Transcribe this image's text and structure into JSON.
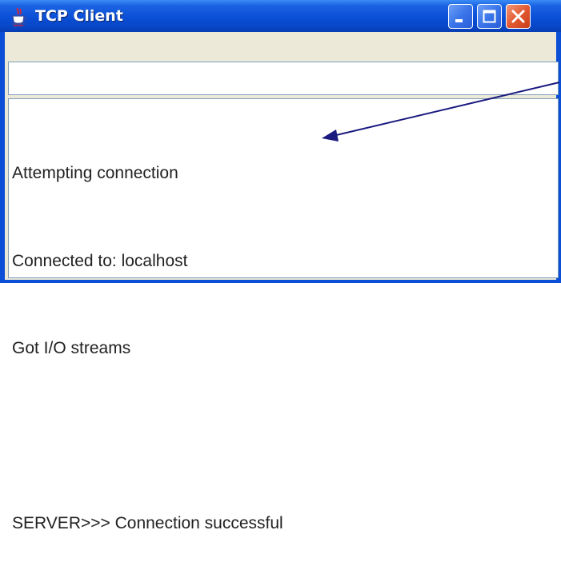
{
  "window": {
    "title": "TCP Client",
    "title_bar_color": "#0a4fd6",
    "app_icon": "java-coffee-cup-icon",
    "buttons": {
      "minimize_icon": "minimize-icon",
      "maximize_icon": "maximize-icon",
      "close_icon": "close-icon",
      "close_color": "#e35a32"
    }
  },
  "input": {
    "value": "",
    "placeholder": ""
  },
  "output": {
    "lines": [
      "Attempting connection",
      "Connected to: localhost",
      "Got I/O streams",
      "",
      "SERVER>>> Connection successful"
    ]
  },
  "annotation": {
    "icon": "arrow-icon",
    "color": "#1a1a80"
  }
}
